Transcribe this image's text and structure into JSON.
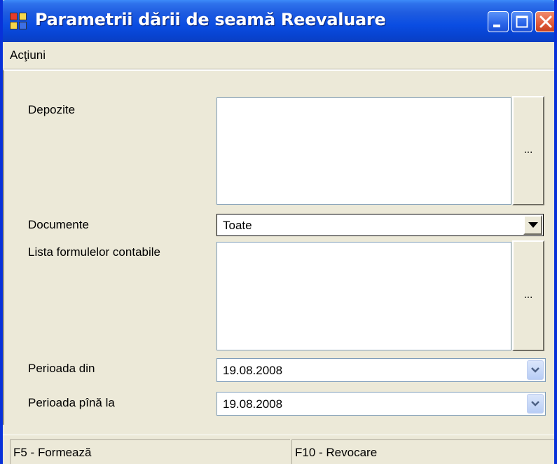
{
  "window": {
    "title": "Parametrii dării de seamă Reevaluare",
    "controls": [
      "minimize",
      "maximize",
      "close"
    ]
  },
  "menu": {
    "items": [
      {
        "label": "Acţiuni"
      }
    ]
  },
  "form": {
    "depozite": {
      "label": "Depozite",
      "button_label": "..."
    },
    "documente": {
      "label": "Documente",
      "value": "Toate"
    },
    "formule": {
      "label": "Lista formulelor contabile",
      "button_label": "..."
    },
    "perioada_din": {
      "label": "Perioada din",
      "value": "19.08.2008"
    },
    "perioada_pina": {
      "label": "Perioada pînă la",
      "value": "19.08.2008"
    }
  },
  "status": {
    "left": "F5 - Formează",
    "right": "F10 - Revocare"
  },
  "colors": {
    "titlebar": "#0a4de2",
    "window_bg": "#ece9d8",
    "border": "#0831d9",
    "close_button": "#e05a3a"
  }
}
